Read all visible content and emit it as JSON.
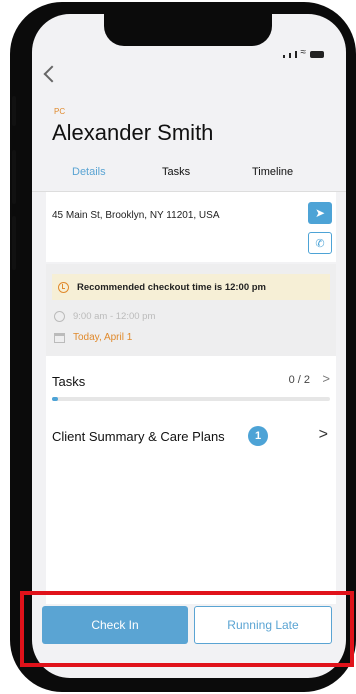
{
  "client": {
    "type": "PC",
    "name": "Alexander Smith"
  },
  "tabs": [
    "Details",
    "Tasks",
    "Timeline"
  ],
  "address": "45 Main St, Brooklyn, NY 11201, USA",
  "icons": {
    "back": "chevron-left-icon",
    "navigate": "navigation-arrow-icon",
    "call": "phone-call-icon",
    "alarm": "alarm-clock-icon",
    "clock": "clock-icon",
    "calendar": "calendar-icon"
  },
  "visit": {
    "checkout_notice": "Recommended checkout time is 12:00 pm",
    "time_range": "9:00 am - 12:00 pm",
    "date": "Today, April 1"
  },
  "tasks": {
    "label": "Tasks",
    "count": "0 / 2",
    "chevron": ">",
    "progress": 0.02
  },
  "care_plans": {
    "label": "Client Summary & Care Plans",
    "badge": "1",
    "chevron": ">"
  },
  "actions": {
    "check_in": "Check In",
    "running_late": "Running Late"
  },
  "colors": {
    "accent": "#4da3d6",
    "warning": "#e08a2d",
    "highlight": "#e0121a"
  }
}
